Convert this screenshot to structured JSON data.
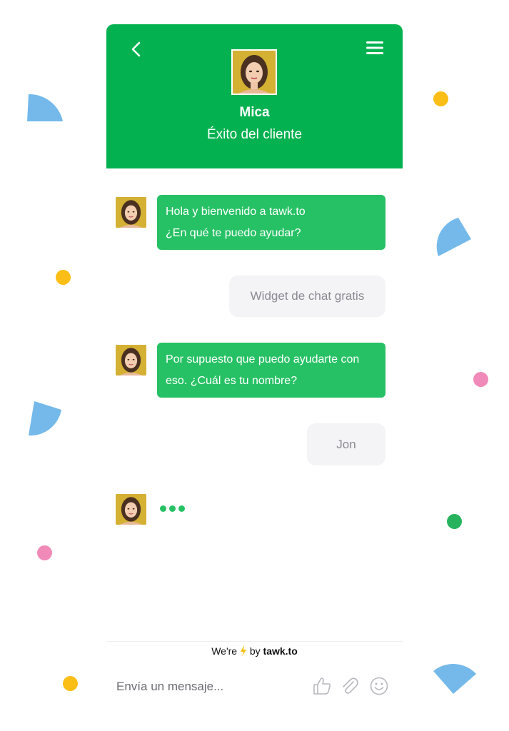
{
  "header": {
    "agent_name": "Mica",
    "agent_role": "Éxito del cliente"
  },
  "messages": [
    {
      "from": "agent",
      "lines": [
        "Hola y bienvenido a tawk.to",
        "¿En qué te puedo ayudar?"
      ]
    },
    {
      "from": "user",
      "text": "Widget de chat gratis"
    },
    {
      "from": "agent",
      "lines": [
        "Por supuesto que puedo ayudarte con",
        "eso. ¿Cuál es tu nombre?"
      ]
    },
    {
      "from": "user",
      "text": "Jon"
    }
  ],
  "footer": {
    "branding_prefix": "We're",
    "branding_icon": "lightning-icon",
    "branding_by": "by",
    "branding_name": "tawk.to",
    "input_placeholder": "Envía un mensaje..."
  },
  "colors": {
    "header_green": "#03b150",
    "bubble_green": "#27c165",
    "user_bubble": "#f4f4f6",
    "decor_blue": "#74b9ea",
    "decor_yellow": "#fbbe16",
    "decor_pink": "#f08ab8",
    "decor_green": "#27b35e"
  },
  "icons": [
    "back-arrow-icon",
    "hamburger-menu-icon",
    "thumbs-up-icon",
    "paperclip-icon",
    "emoji-icon",
    "typing-indicator-icon"
  ]
}
